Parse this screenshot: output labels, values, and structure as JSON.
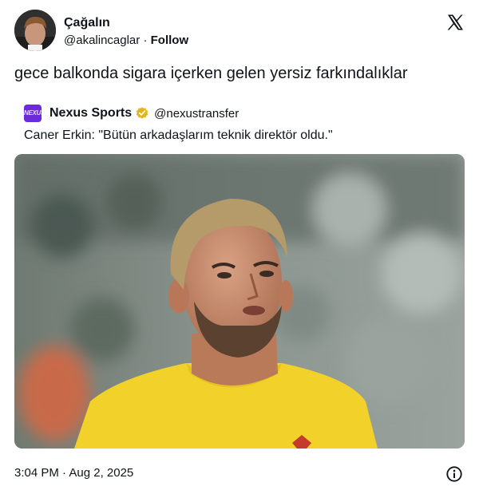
{
  "author": {
    "display_name": "Çağalın",
    "handle": "@akalincaglar",
    "separator": "·",
    "follow_label": "Follow"
  },
  "tweet": {
    "text": "gece balkonda sigara içerken gelen yersiz farkındalıklar",
    "timestamp": "3:04 PM · Aug 2, 2025"
  },
  "quoted": {
    "avatar_text": "NEXUS",
    "display_name": "Nexus Sports",
    "handle": "@nexustransfer",
    "text": "Caner Erkin: \"Bütün arkadaşlarım teknik direktör oldu.\""
  },
  "icons": {
    "platform_logo": "x-logo-icon",
    "verified": "verified-badge-icon",
    "info": "info-icon"
  },
  "colors": {
    "text": "#0f1419",
    "verified_gold": "#e2b719",
    "quote_avatar_bg": "#6b2bd8",
    "jersey_yellow": "#f2d22a"
  }
}
